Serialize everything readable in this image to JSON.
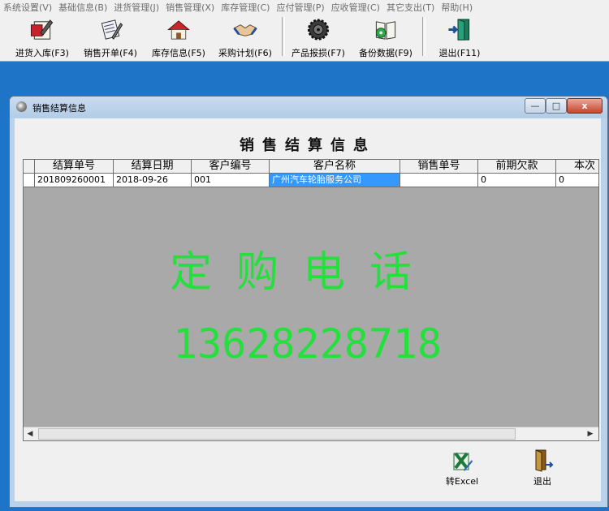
{
  "menu": [
    "系统设置(V)",
    "基础信息(B)",
    "进货管理(J)",
    "销售管理(X)",
    "库存管理(C)",
    "应付管理(P)",
    "应收管理(C)",
    "其它支出(T)",
    "帮助(H)"
  ],
  "toolbar": {
    "purchase_in": "进货入库(F3)",
    "sales_order": "销售开单(F4)",
    "stock_info": "库存信息(F5)",
    "purchase_plan": "采购计划(F6)",
    "product_loss": "产品报损(F7)",
    "backup": "备份数据(F9)",
    "exit": "退出(F11)"
  },
  "window": {
    "title": "销售结算信息",
    "heading": "销售结算信息",
    "minimize": "—",
    "maximize": "□",
    "close": "x"
  },
  "table": {
    "columns": [
      "结算单号",
      "结算日期",
      "客户编号",
      "客户名称",
      "销售单号",
      "前期欠款",
      "本次"
    ],
    "rows": [
      {
        "settle_no": "201809260001",
        "date": "2018-09-26",
        "cust_no": "001",
        "cust_name": "广州汽车轮胎服务公司",
        "sale_no": "",
        "prev_debt": "0",
        "current": "0"
      }
    ]
  },
  "watermark": {
    "line1": "定购电话",
    "line2": "13628228718"
  },
  "buttons": {
    "excel": "转Excel",
    "exit": "退出"
  },
  "colors": {
    "desktop": "#1e74c6",
    "selection": "#3399ff",
    "watermark": "#24e03c"
  }
}
